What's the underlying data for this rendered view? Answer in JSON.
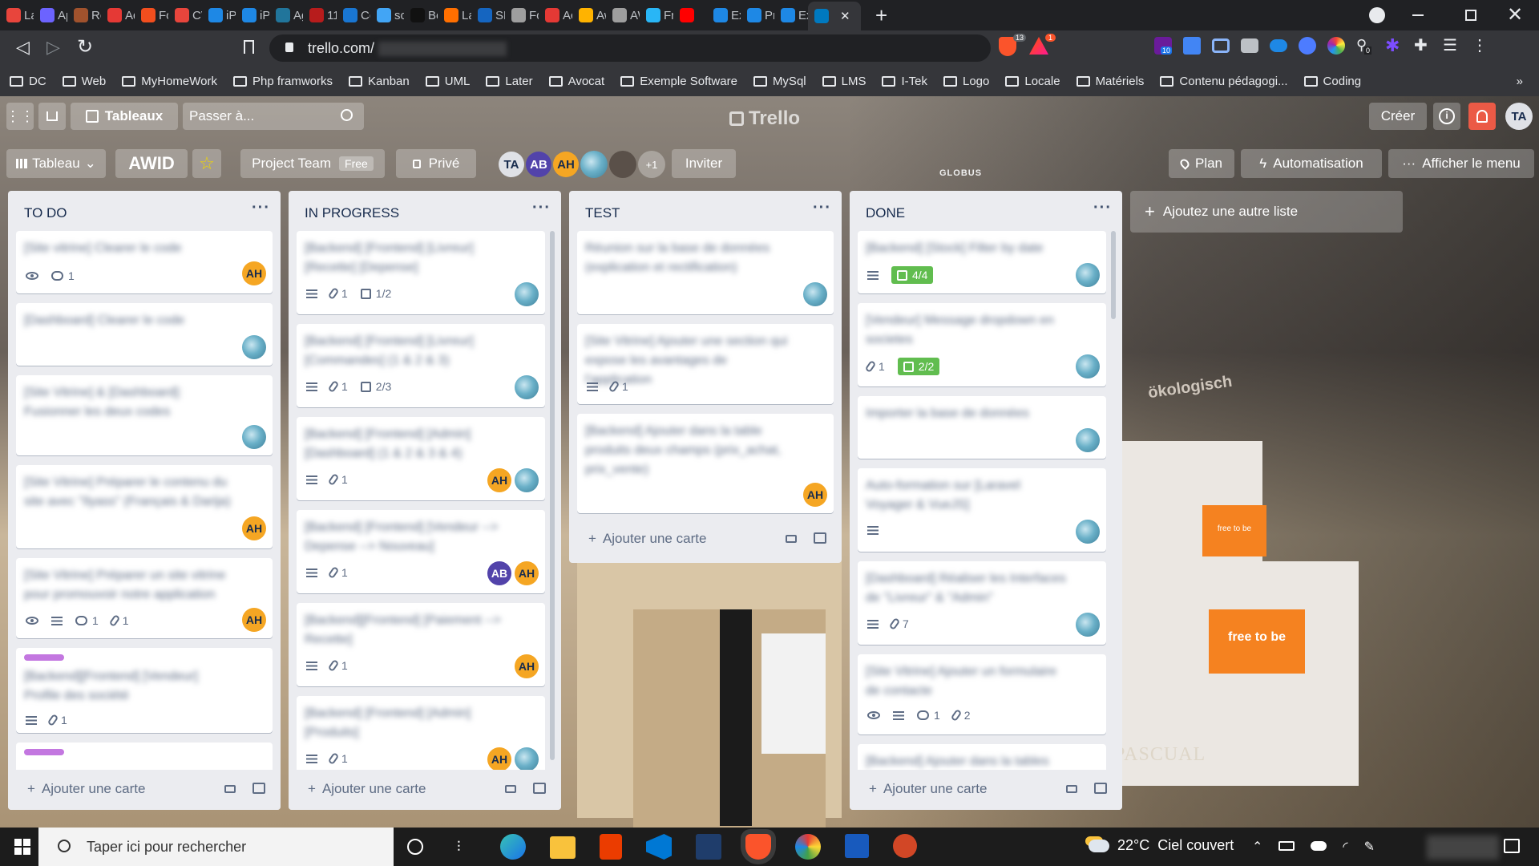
{
  "browser": {
    "tabs": [
      {
        "label": "La p",
        "color": "#e8453c"
      },
      {
        "label": "Ape",
        "color": "#6c63ff"
      },
      {
        "label": "Rob",
        "color": "#a0522d"
      },
      {
        "label": "Adv",
        "color": "#e53935"
      },
      {
        "label": "For",
        "color": "#f24e1e"
      },
      {
        "label": "CV",
        "color": "#e8453c"
      },
      {
        "label": "iPor",
        "color": "#1e88e5"
      },
      {
        "label": "iPor",
        "color": "#1e88e5"
      },
      {
        "label": "Age",
        "color": "#21759b"
      },
      {
        "label": "116",
        "color": "#b71c1c"
      },
      {
        "label": "Cor",
        "color": "#1976d2"
      },
      {
        "label": "sofi",
        "color": "#42a5f5"
      },
      {
        "label": "Bea",
        "color": "#111111"
      },
      {
        "label": "La r",
        "color": "#ff6f00"
      },
      {
        "label": "SEM",
        "color": "#1565c0"
      },
      {
        "label": "For",
        "color": "#9e9e9e"
      },
      {
        "label": "Acc",
        "color": "#e53935"
      },
      {
        "label": "Awi",
        "color": "#ffb300"
      },
      {
        "label": "AW",
        "color": "#9e9e9e"
      },
      {
        "label": "Fre",
        "color": "#29b6f6"
      },
      {
        "label": "",
        "color": "#ff0000"
      },
      {
        "label": "Exe",
        "color": "#1e88e5"
      },
      {
        "label": "Pro",
        "color": "#1e88e5"
      },
      {
        "label": "Exe",
        "color": "#1e88e5"
      }
    ],
    "url": "trello.com/",
    "new_tab": "+",
    "bookmarks": [
      "DC",
      "Web",
      "MyHomeWork",
      "Php framworks",
      "Kanban",
      "UML",
      "Later",
      "Avocat",
      "Exemple Software",
      "MySql",
      "LMS",
      "I-Tek",
      "Logo",
      "Locale",
      "Matériels",
      "Contenu pédagogi...",
      "Coding"
    ],
    "more_bookmarks": "»",
    "ext_badge_1": "10",
    "ext_badge_2": "0",
    "brave_badge": "13",
    "rewards_badge": "1"
  },
  "trello": {
    "boards_label": "Tableaux",
    "search_placeholder": "Passer à...",
    "logo": "Trello",
    "create_label": "Créer",
    "user_initials": "TA",
    "view_label": "Tableau",
    "board_name": "AWID",
    "workspace": "Project Team",
    "workspace_plan": "Free",
    "visibility": "Privé",
    "members": [
      {
        "initials": "TA",
        "color": "#dfe1e6"
      },
      {
        "initials": "AB",
        "color": "#5243aa"
      },
      {
        "initials": "AH",
        "color": "#f5a623"
      }
    ],
    "extra_members": "+1",
    "invite_label": "Inviter",
    "plan_label": "Plan",
    "automation_label": "Automatisation",
    "show_menu_label": "Afficher le menu",
    "add_list_label": "Ajoutez une autre liste",
    "add_card_label": "Ajouter une carte",
    "lists": [
      {
        "title": "TO DO",
        "cards": [
          {
            "text": "[Site vitrine] Clearer le code",
            "watch": true,
            "comments": "1",
            "member": "AH"
          },
          {
            "text": "[Dashboard] Clearer le code",
            "member": "photo"
          },
          {
            "text": "[Site Vitrine] & [Dashboard]: Fusionner les deux codes",
            "member": "photo"
          },
          {
            "text": "[Site Vitrine] Préparer le contenu du site avec \"Ilyass\" (Français & Darija)",
            "member": "AH"
          },
          {
            "text": "[Site Vitrine] Préparer un site vitrine pour promouvoir notre application",
            "watch": true,
            "desc": true,
            "comments": "1",
            "attachments": "1",
            "member": "AH"
          },
          {
            "text": "[Backend][Frontend] [Vendeur] Profile des société",
            "label": true,
            "desc": true,
            "attachments": "1"
          }
        ]
      },
      {
        "title": "IN PROGRESS",
        "cards": [
          {
            "text": "[Backend] [Frontend] [Livreur] [Recette] [Depense]",
            "desc": true,
            "attachments": "1",
            "checklist": "1/2",
            "member": "photo"
          },
          {
            "text": "[Backend] [Frontend] [Livreur] [Commandes] (1 & 2 & 3)",
            "desc": true,
            "attachments": "1",
            "checklist": "2/3",
            "member": "photo"
          },
          {
            "text": "[Backend] [Frontend] [Admin] [Dashboard] (1 & 2 & 3 & 4)",
            "desc": true,
            "attachments": "1",
            "member": "AH+photo"
          },
          {
            "text": "[Backend] [Frontend] [Vendeur --> Depense --> Nouveau]",
            "desc": true,
            "attachments": "1",
            "member": "AB+AH"
          },
          {
            "text": "[Backend][Frontend] [Paiement --> Recette]",
            "desc": true,
            "attachments": "1",
            "member": "AH"
          },
          {
            "text": "[Backend] [Frontend] [Admin] [Produits]",
            "desc": true,
            "attachments": "1",
            "member": "AH+photo"
          }
        ]
      },
      {
        "title": "TEST",
        "cards": [
          {
            "text": "Réunion sur la base de données (explication et rectification)",
            "member": "photo"
          },
          {
            "text": "[Site Vitrine] Ajouter une section qui expose les avantages de l'application",
            "desc": true,
            "attachments": "1"
          },
          {
            "text": "[Backend] Ajouter dans la table produits deux champs (prix_achat, prix_vente)",
            "member": "AH"
          }
        ]
      },
      {
        "title": "DONE",
        "cards": [
          {
            "text": "[Backend] [Stock] Filter by date",
            "desc": true,
            "checklist_done": "4/4",
            "member": "photo"
          },
          {
            "text": "[Vendeur] Message dropdown en societes",
            "attachments": "1",
            "checklist_done": "2/2",
            "member": "photo"
          },
          {
            "text": "Importer la base de données",
            "member": "photo"
          },
          {
            "text": "Auto-formation sur [Laravel Voyager & VueJS]",
            "desc": true,
            "member": "photo"
          },
          {
            "text": "[Dashboard] Réaliser les Interfaces de \"Livreur\" & \"Admin\"",
            "desc": true,
            "attachments": "7",
            "member": "photo"
          },
          {
            "text": "[Site Vitrine] Ajouter un formulaire de contacte",
            "watch": true,
            "desc": true,
            "comments": "1",
            "attachments": "2"
          },
          {
            "text": "[Backend] Ajouter dans la tables"
          }
        ]
      }
    ]
  },
  "background_text": {
    "sticker_1": "free to be",
    "sticker_2": "free to be",
    "brand_1": "ökologisch",
    "brand_2": "PASCUAL",
    "brand_3": "GLOBUS"
  },
  "taskbar": {
    "search_placeholder": "Taper ici pour rechercher",
    "weather_temp": "22°C",
    "weather_text": "Ciel couvert"
  }
}
